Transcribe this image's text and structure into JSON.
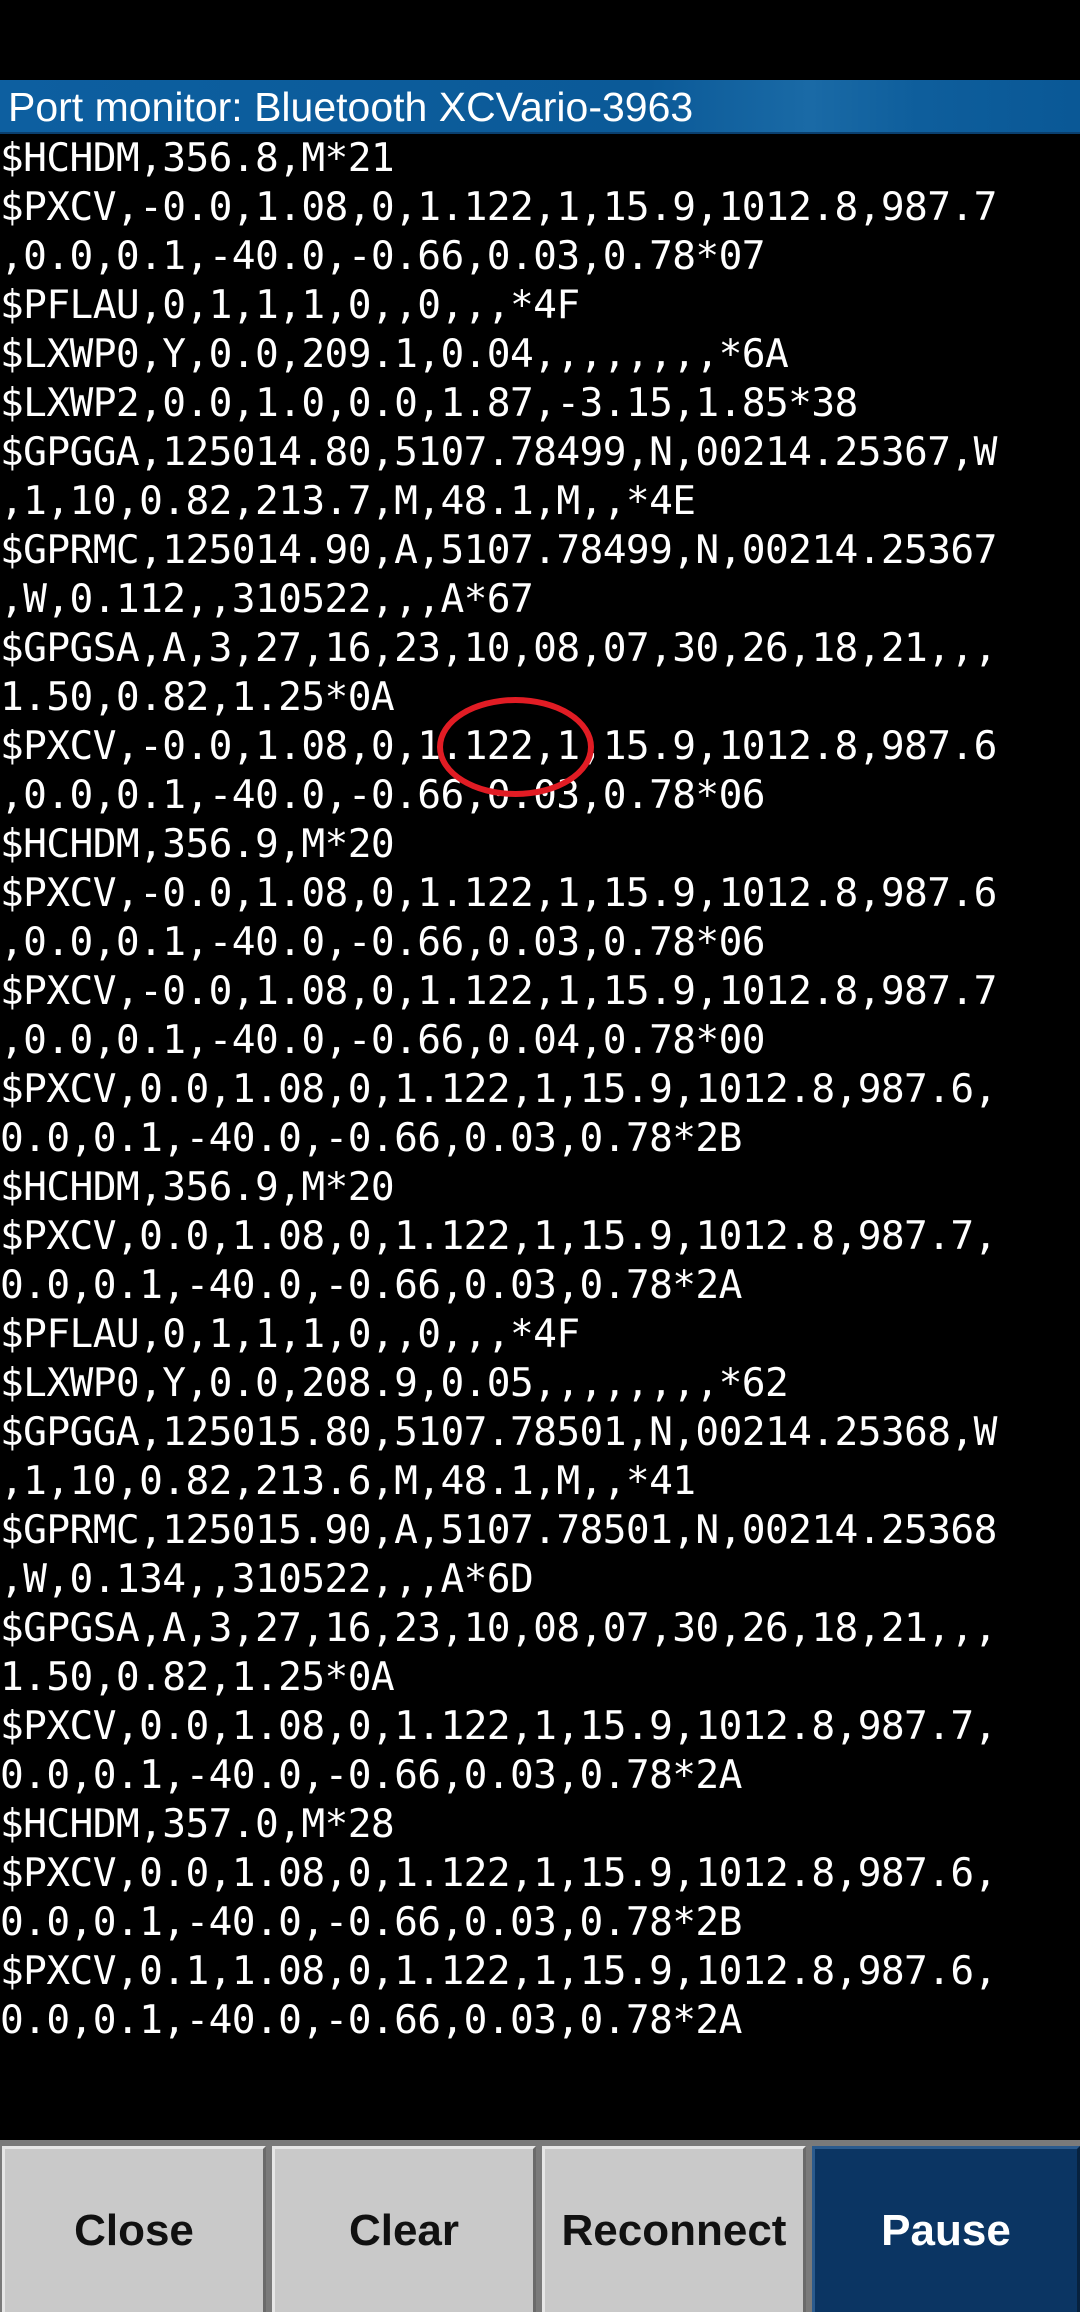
{
  "window": {
    "title": "Port monitor: Bluetooth XCVario-3963"
  },
  "log_lines": [
    "$HCHDM,356.8,M*21",
    "$PXCV,-0.0,1.08,0,1.122,1,15.9,1012.8,987.7",
    ",0.0,0.1,-40.0,-0.66,0.03,0.78*07",
    "$PFLAU,0,1,1,1,0,,0,,,*4F",
    "$LXWP0,Y,0.0,209.1,0.04,,,,,,,,*6A",
    "$LXWP2,0.0,1.0,0.0,1.87,-3.15,1.85*38",
    "$GPGGA,125014.80,5107.78499,N,00214.25367,W",
    ",1,10,0.82,213.7,M,48.1,M,,*4E",
    "$GPRMC,125014.90,A,5107.78499,N,00214.25367",
    ",W,0.112,,310522,,,A*67",
    "$GPGSA,A,3,27,16,23,10,08,07,30,26,18,21,,,",
    "1.50,0.82,1.25*0A",
    "$PXCV,-0.0,1.08,0,1.122,1,15.9,1012.8,987.6",
    ",0.0,0.1,-40.0,-0.66,0.03,0.78*06",
    "$HCHDM,356.9,M*20",
    "$PXCV,-0.0,1.08,0,1.122,1,15.9,1012.8,987.6",
    ",0.0,0.1,-40.0,-0.66,0.03,0.78*06",
    "$PXCV,-0.0,1.08,0,1.122,1,15.9,1012.8,987.7",
    ",0.0,0.1,-40.0,-0.66,0.04,0.78*00",
    "$PXCV,0.0,1.08,0,1.122,1,15.9,1012.8,987.6,",
    "0.0,0.1,-40.0,-0.66,0.03,0.78*2B",
    "$HCHDM,356.9,M*20",
    "$PXCV,0.0,1.08,0,1.122,1,15.9,1012.8,987.7,",
    "0.0,0.1,-40.0,-0.66,0.03,0.78*2A",
    "$PFLAU,0,1,1,1,0,,0,,,*4F",
    "$LXWP0,Y,0.0,208.9,0.05,,,,,,,,*62",
    "$GPGGA,125015.80,5107.78501,N,00214.25368,W",
    ",1,10,0.82,213.6,M,48.1,M,,*41",
    "$GPRMC,125015.90,A,5107.78501,N,00214.25368",
    ",W,0.134,,310522,,,A*6D",
    "$GPGSA,A,3,27,16,23,10,08,07,30,26,18,21,,,",
    "1.50,0.82,1.25*0A",
    "$PXCV,0.0,1.08,0,1.122,1,15.9,1012.8,987.7,",
    "0.0,0.1,-40.0,-0.66,0.03,0.78*2A",
    "$HCHDM,357.0,M*28",
    "$PXCV,0.0,1.08,0,1.122,1,15.9,1012.8,987.6,",
    "0.0,0.1,-40.0,-0.66,0.03,0.78*2B",
    "$PXCV,0.1,1.08,0,1.122,1,15.9,1012.8,987.6,",
    "0.0,0.1,-40.0,-0.66,0.03,0.78*2A"
  ],
  "annotation": {
    "highlighted_value": "1.122",
    "color": "#e11c24"
  },
  "buttons": {
    "close": "Close",
    "clear": "Clear",
    "reconnect": "Reconnect",
    "pause": "Pause"
  },
  "colors": {
    "title_bar": "#0b5a98",
    "background": "#000000",
    "text": "#ffffff",
    "button_light": "#c9c9c9",
    "button_active": "#0b3563"
  }
}
